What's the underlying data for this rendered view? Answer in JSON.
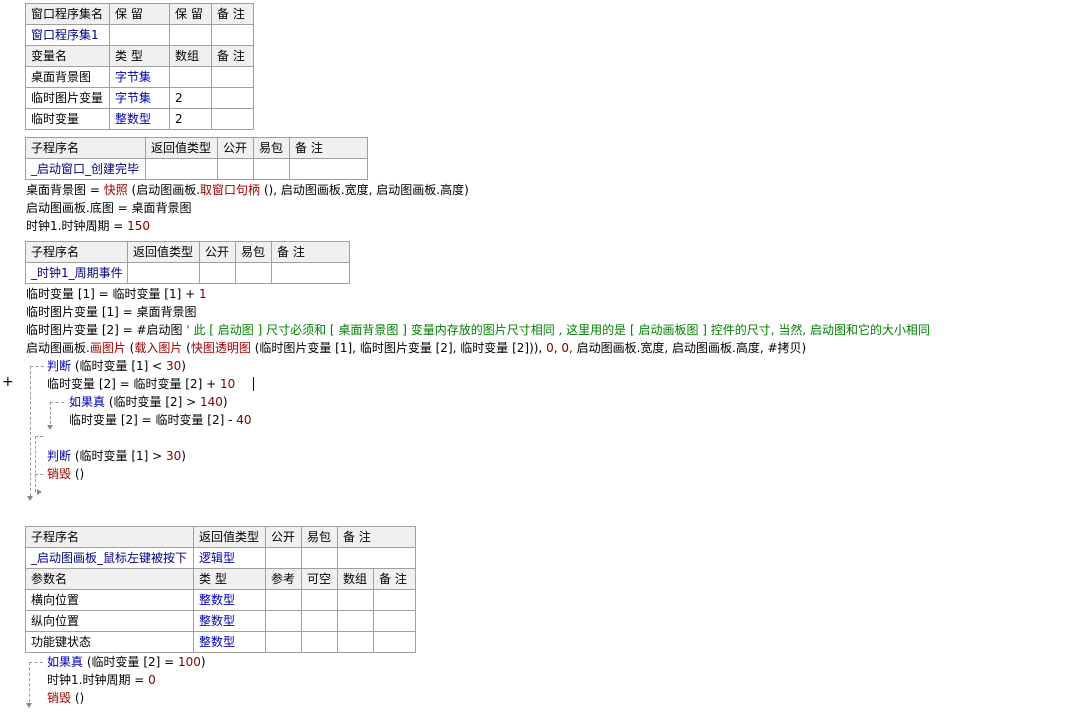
{
  "t1": {
    "header": [
      "窗口程序集名",
      "保 留",
      "保 留",
      "备 注"
    ],
    "row1": [
      "窗口程序集1",
      "",
      "",
      ""
    ],
    "header2": [
      "变量名",
      "类 型",
      "数组",
      "备 注"
    ],
    "rows": [
      [
        "桌面背景图",
        "字节集",
        "",
        ""
      ],
      [
        "临时图片变量",
        "字节集",
        "2",
        ""
      ],
      [
        "临时变量",
        "整数型",
        "2",
        ""
      ]
    ]
  },
  "t2": {
    "header": [
      "子程序名",
      "返回值类型",
      "公开",
      "易包",
      "备 注"
    ],
    "row1": [
      "_启动窗口_创建完毕",
      "",
      "",
      "",
      ""
    ]
  },
  "code1": {
    "l1": {
      "a": "桌面背景图 = ",
      "b": "快照",
      "c": " (启动图画板.",
      "d": "取窗口句柄",
      "e": " (), 启动图画板.宽度, 启动图画板.高度)"
    },
    "l2": "启动图画板.底图 = 桌面背景图",
    "l3": {
      "a": "时钟1.时钟周期 = ",
      "b": "150"
    }
  },
  "t3": {
    "header": [
      "子程序名",
      "返回值类型",
      "公开",
      "易包",
      "备 注"
    ],
    "row1": [
      "_时钟1_周期事件",
      "",
      "",
      "",
      ""
    ]
  },
  "code2": {
    "l1": {
      "a": "临时变量 [1] = 临时变量 [1] + ",
      "b": "1"
    },
    "l2": "临时图片变量 [1] = 桌面背景图",
    "l3": {
      "a": "临时图片变量 [2] = #启动图 ",
      "b": "' 此 [ 启动图 ] 尺寸必须和 [ 桌面背景图 ] 变量内存放的图片尺寸相同 , 这里用的是 [ 启动画板图 ] 控件的尺寸, 当然, 启动图和它的大小相同"
    },
    "l4": {
      "a": "启动图画板.",
      "b": "画图片",
      "c": " (",
      "d": "载入图片",
      "e": " (",
      "f": "快图透明图",
      "g": " (临时图片变量 [1], 临时图片变量 [2], 临时变量 [2])), ",
      "h": "0, 0,",
      "i": " 启动图画板.宽度, 启动图画板.高度, #拷贝)"
    },
    "l5": {
      "a": "判断",
      "b": " (临时变量 [1] < ",
      "c": "30",
      "d": ")"
    },
    "l6": {
      "a": "临时变量 [2] = 临时变量 [2] + ",
      "b": "10"
    },
    "l7": {
      "a": "如果真",
      "b": " (临时变量 [2] > ",
      "c": "140",
      "d": ")"
    },
    "l8": {
      "a": "临时变量 [2] = 临时变量 [2] - ",
      "b": "40"
    },
    "l9": {
      "a": "判断",
      "b": " (临时变量 [1] > ",
      "c": "30",
      "d": ")"
    },
    "l10": {
      "a": "销毁",
      "b": " ()"
    },
    "plus": "+"
  },
  "t4": {
    "header": [
      "子程序名",
      "返回值类型",
      "公开",
      "易包",
      "备 注"
    ],
    "row1": [
      "_启动图画板_鼠标左键被按下",
      "逻辑型",
      "",
      "",
      ""
    ],
    "header2": [
      "参数名",
      "类 型",
      "参考",
      "可空",
      "数组",
      "备 注"
    ],
    "rows": [
      [
        "横向位置",
        "整数型",
        "",
        "",
        "",
        ""
      ],
      [
        "纵向位置",
        "整数型",
        "",
        "",
        "",
        ""
      ],
      [
        "功能键状态",
        "整数型",
        "",
        "",
        "",
        ""
      ]
    ]
  },
  "code3": {
    "l1": {
      "a": "如果真",
      "b": " (临时变量 [2] = ",
      "c": "100",
      "d": ")"
    },
    "l2": {
      "a": "时钟1.时钟周期 = ",
      "b": "0"
    },
    "l3": {
      "a": "销毁",
      "b": " ()"
    }
  },
  "colors": {
    "keyword": "#0000b0",
    "func": "#a00000",
    "comment": "#008000",
    "number": "#800000",
    "border": "#a0a0a0"
  }
}
